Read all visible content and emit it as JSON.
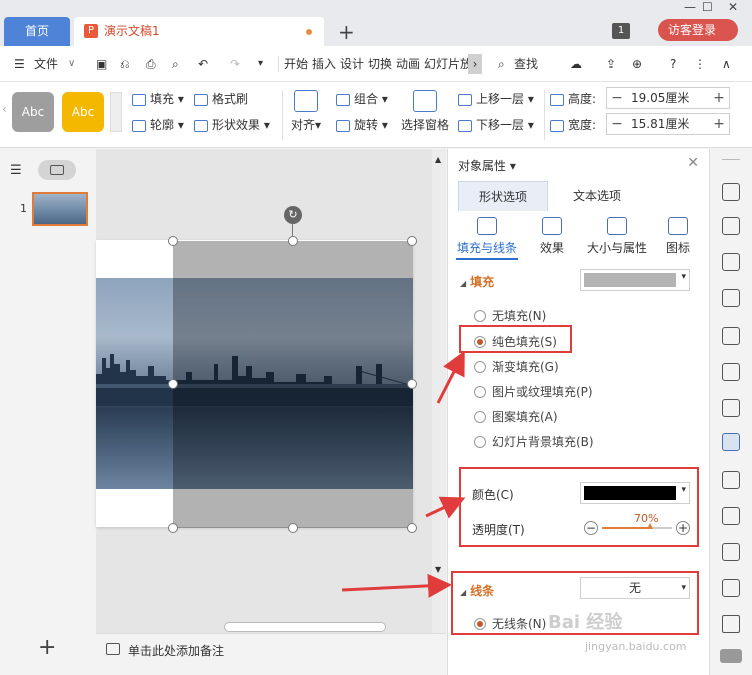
{
  "titlebar": {
    "home_tab": "首页",
    "doc_tab": "演示文稿1",
    "add_tab": "+",
    "page_count": "1",
    "visitor_login": "访客登录"
  },
  "menubar": {
    "file": "文件",
    "items": [
      "开始",
      "插入",
      "设计",
      "切换",
      "动画",
      "幻灯片放"
    ],
    "search": "查找"
  },
  "ribbon": {
    "style_abc_1": "Abc",
    "style_abc_2": "Abc",
    "fill": "填充",
    "format_brush": "格式刷",
    "outline": "轮廓",
    "shape_effect": "形状效果",
    "align": "对齐",
    "group": "组合",
    "rotate": "旋转",
    "selection_pane": "选择窗格",
    "bring_forward": "上移一层",
    "send_backward": "下移一层",
    "height_label": "高度:",
    "height_value": "19.05厘米",
    "width_label": "宽度:",
    "width_value": "15.81厘米"
  },
  "thumbs": {
    "slide_number": "1"
  },
  "notes": {
    "placeholder": "单击此处添加备注"
  },
  "panel": {
    "title": "对象属性",
    "tabs": [
      "形状选项",
      "文本选项"
    ],
    "subtabs": [
      "填充与线条",
      "效果",
      "大小与属性",
      "图标"
    ],
    "fill_section": "填充",
    "fill_swatch_color": "#b3b3b3",
    "fill_options": [
      "无填充(N)",
      "纯色填充(S)",
      "渐变填充(G)",
      "图片或纹理填充(P)",
      "图案填充(A)",
      "幻灯片背景填充(B)"
    ],
    "fill_selected_index": 1,
    "color_label": "颜色(C)",
    "color_value": "#000000",
    "transparency_label": "透明度(T)",
    "transparency_value": "70%",
    "line_section": "线条",
    "line_select": "无",
    "line_option": "无线条(N)"
  },
  "colors": {
    "accent_blue": "#4f83d8",
    "accent_orange": "#d4722a",
    "highlight_red": "#e03c3c",
    "visitor_red": "#d9534f"
  },
  "watermark": {
    "text": "Bai 经验",
    "sub": "jingyan.baidu.com"
  }
}
